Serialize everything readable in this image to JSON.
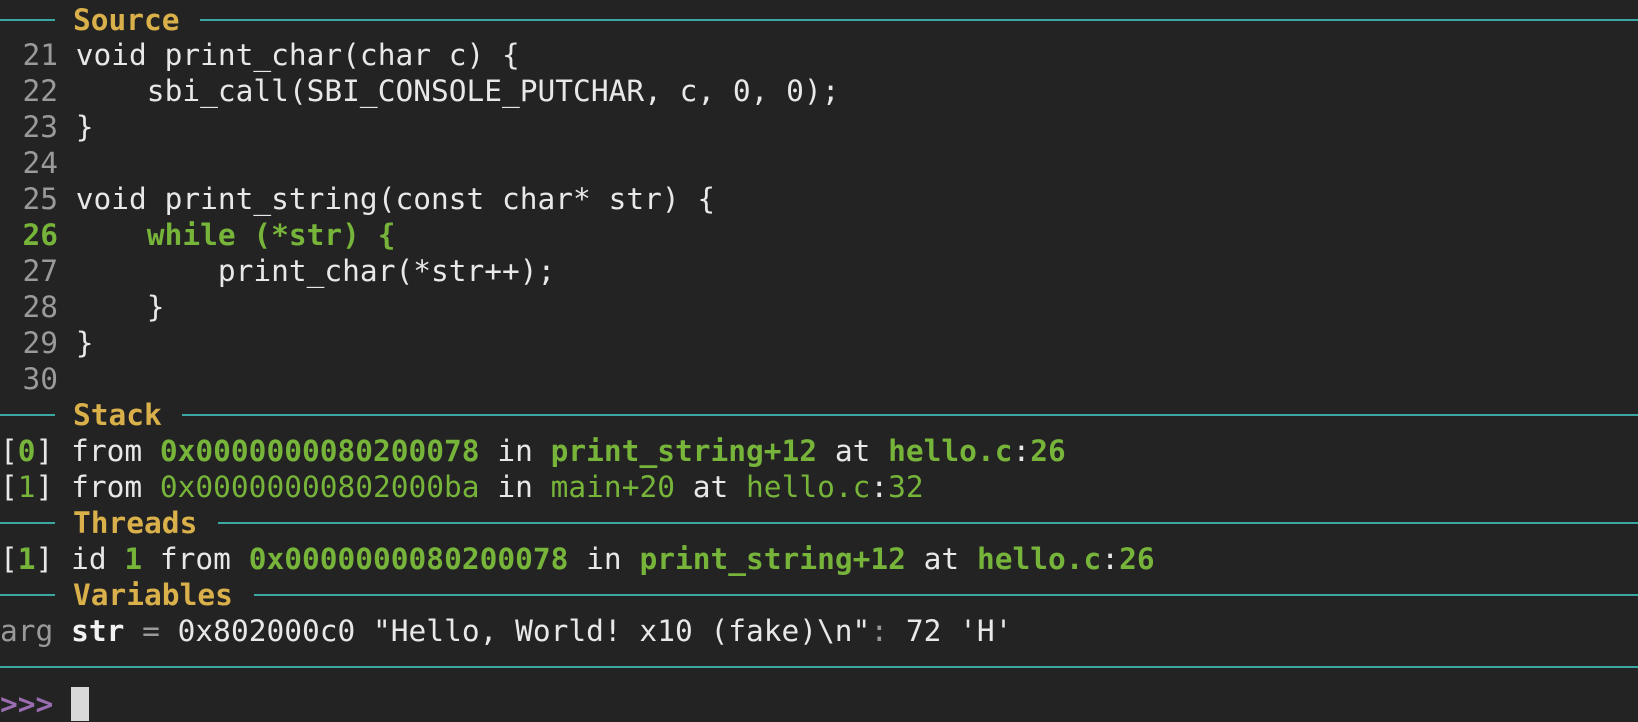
{
  "sections": {
    "source": "Source",
    "stack": "Stack",
    "threads": "Threads",
    "variables": "Variables"
  },
  "source_lines": [
    {
      "no": "21",
      "code": " void print_char(char c) {"
    },
    {
      "no": "22",
      "code": "     sbi_call(SBI_CONSOLE_PUTCHAR, c, 0, 0);"
    },
    {
      "no": "23",
      "code": " }"
    },
    {
      "no": "24",
      "code": ""
    },
    {
      "no": "25",
      "code": " void print_string(const char* str) {"
    },
    {
      "no": "26",
      "code": "     while (*str) {"
    },
    {
      "no": "27",
      "code": "         print_char(*str++);"
    },
    {
      "no": "28",
      "code": "     }"
    },
    {
      "no": "29",
      "code": " }"
    },
    {
      "no": "30",
      "code": ""
    }
  ],
  "current_line": "26",
  "stack": [
    {
      "idx": "0",
      "from": "from",
      "addr": "0x0000000080200078",
      "in": "in",
      "func": "print_string",
      "offset": "+12",
      "at": "at",
      "file": "hello.c",
      "line": "26"
    },
    {
      "idx": "1",
      "from": "from",
      "addr": "0x00000000802000ba",
      "in": "in",
      "func": "main",
      "offset": "+20",
      "at": "at",
      "file": "hello.c",
      "line": "32"
    }
  ],
  "threads": [
    {
      "idx": "1",
      "id_label": "id",
      "id": "1",
      "from": "from",
      "addr": "0x0000000080200078",
      "in": "in",
      "func": "print_string",
      "offset": "+12",
      "at": "at",
      "file": "hello.c",
      "line": "26"
    }
  ],
  "variables": [
    {
      "kind": "arg",
      "name": "str",
      "eq": "=",
      "value": "0x802000c0 \"Hello, World! x10 (fake)\\n\"",
      "sep": ":",
      "deref": " 72 'H'"
    }
  ],
  "prompt": ">>>"
}
